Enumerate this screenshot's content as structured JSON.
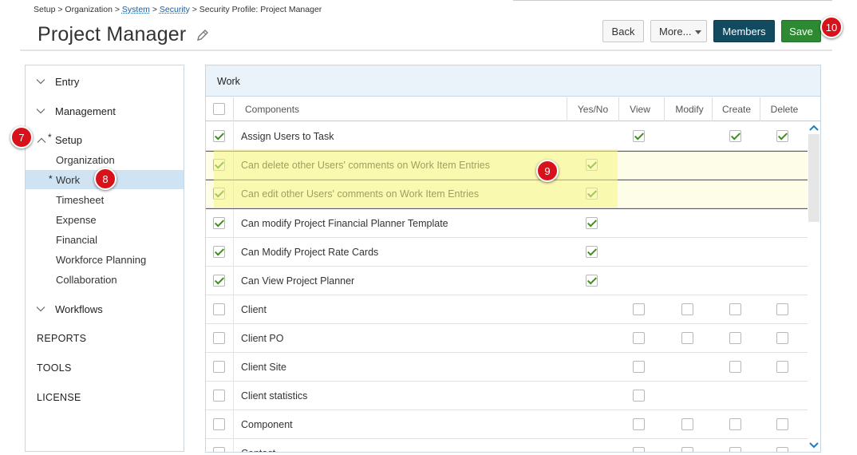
{
  "breadcrumb": {
    "part1": "Setup > Organization > ",
    "system": "System",
    "sep1": " > ",
    "security": "Security",
    "part2": " > Security Profile: Project Manager"
  },
  "title": "Project Manager",
  "buttons": {
    "back": "Back",
    "more": "More...",
    "members": "Members",
    "save": "Save"
  },
  "markers": {
    "m7": "7",
    "m8": "8",
    "m9": "9",
    "m10": "10"
  },
  "sidebar": {
    "groups": {
      "entry": "Entry",
      "management": "Management",
      "setup": "Setup",
      "workflows": "Workflows"
    },
    "setup_star": "*",
    "work_star": "*",
    "setup_items": [
      "Organization",
      "Work",
      "Timesheet",
      "Expense",
      "Financial",
      "Workforce Planning",
      "Collaboration"
    ],
    "reports": "REPORTS",
    "tools": "TOOLS",
    "license": "LICENSE"
  },
  "panel": {
    "title": "Work",
    "headers": {
      "components": "Components",
      "yesno": "Yes/No",
      "view": "View",
      "modify": "Modify",
      "create": "Create",
      "delete": "Delete"
    },
    "rows": [
      {
        "name": "Assign Users to Task"
      },
      {
        "name": "Can delete other Users' comments on Work Item Entries"
      },
      {
        "name": "Can edit other Users' comments on Work Item Entries"
      },
      {
        "name": "Can modify Project Financial Planner Template"
      },
      {
        "name": "Can Modify Project Rate Cards"
      },
      {
        "name": "Can View Project Planner"
      },
      {
        "name": "Client"
      },
      {
        "name": "Client PO"
      },
      {
        "name": "Client Site"
      },
      {
        "name": "Client statistics"
      },
      {
        "name": "Component"
      },
      {
        "name": "Contact"
      }
    ]
  },
  "colors": {
    "members_btn": "#124a60",
    "save_btn": "#2e8a32",
    "marker": "#d7121a",
    "highlight": "#f8f682",
    "active_nav": "#cfe3f3"
  }
}
